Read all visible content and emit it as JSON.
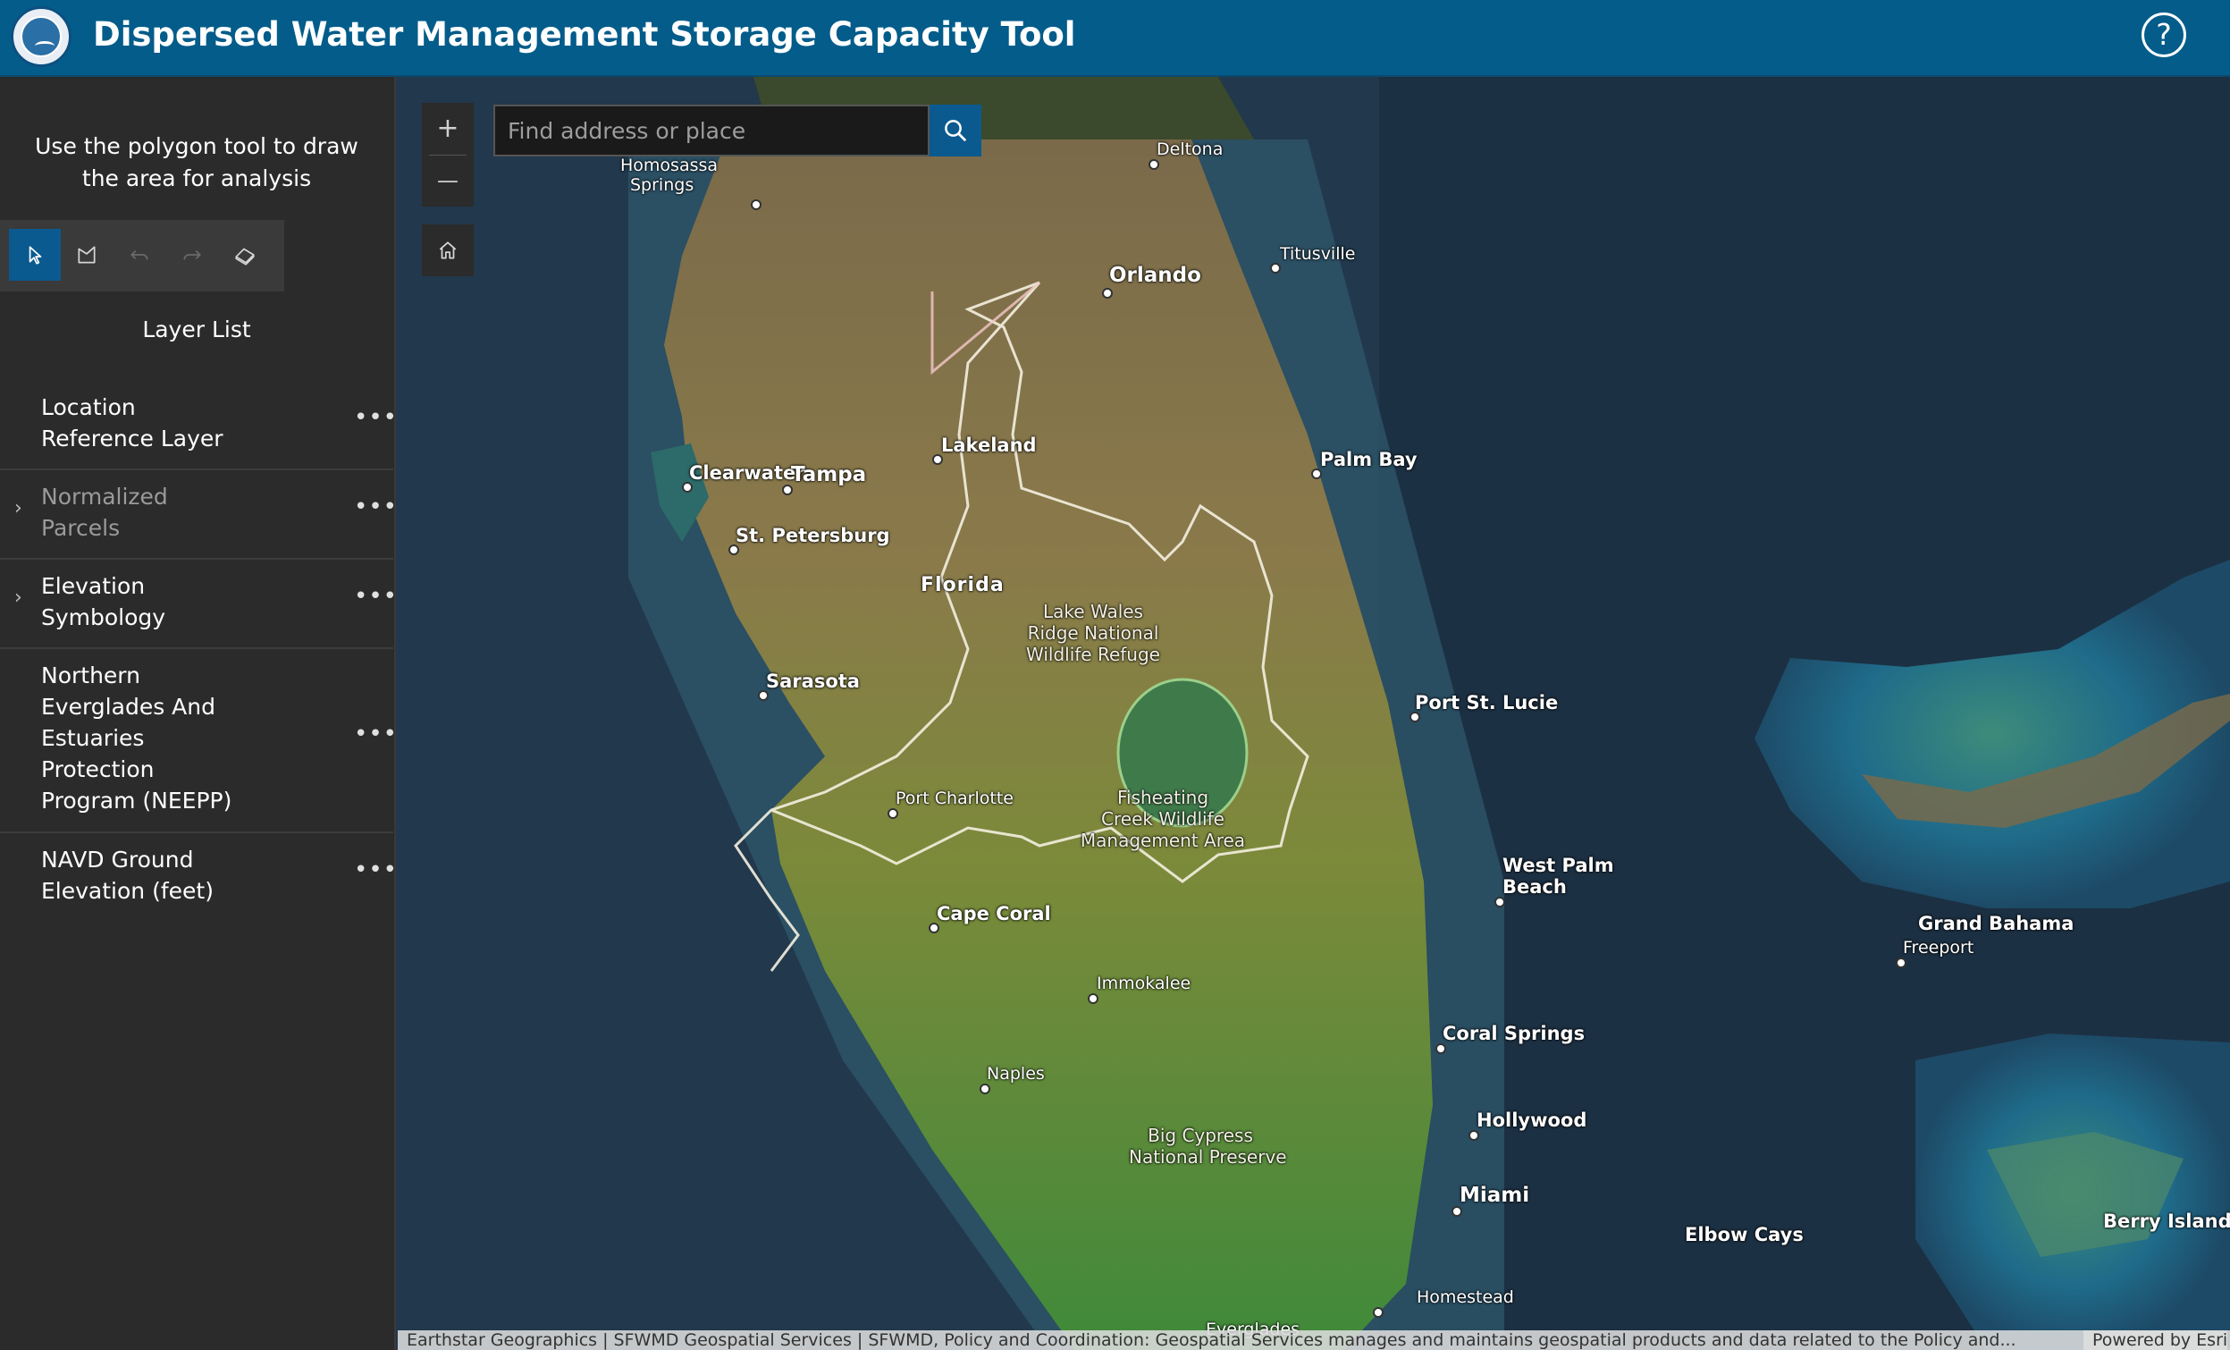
{
  "header": {
    "title": "Dispersed Water Management Storage Capacity Tool",
    "help_label": "?",
    "logo_icon": "district-seal-logo"
  },
  "sidebar": {
    "instructions": "Use the polygon tool to draw the area for analysis",
    "sketch_tools": [
      {
        "name": "select-tool",
        "icon": "cursor-icon",
        "active": true
      },
      {
        "name": "polygon-tool",
        "icon": "polygon-icon",
        "active": false
      },
      {
        "name": "undo-tool",
        "icon": "undo-icon",
        "active": false
      },
      {
        "name": "redo-tool",
        "icon": "redo-icon",
        "active": false
      },
      {
        "name": "erase-tool",
        "icon": "eraser-icon",
        "active": false
      }
    ],
    "layer_list_title": "Layer List",
    "layers": [
      {
        "line1": "Location",
        "line2": "Reference Layer",
        "expandable": false,
        "options": "..."
      },
      {
        "line1": "Normalized",
        "line2": "Parcels",
        "expandable": true,
        "options": "..."
      },
      {
        "line1": "Elevation",
        "line2": "Symbology",
        "expandable": true,
        "options": "..."
      },
      {
        "lines": [
          "Northern",
          "Everglades And",
          "Estuaries",
          "Protection",
          "Program (NEEPP)"
        ],
        "expandable": false,
        "options": "..."
      },
      {
        "line1": "NAVD Ground",
        "line2": "Elevation (feet)",
        "expandable": false,
        "options": "..."
      }
    ],
    "collapse_label": "‹"
  },
  "map": {
    "search": {
      "placeholder": "Find address or place",
      "value": ""
    },
    "zoom_in": "+",
    "zoom_out": "—",
    "labels": {
      "homosassa_1": "Homosassa",
      "homosassa_2": "Springs",
      "deltona": "Deltona",
      "orlando": "Orlando",
      "titusville": "Titusville",
      "lakeland": "Lakeland",
      "palm_bay": "Palm Bay",
      "clearwater": "Clearwater",
      "tampa": "Tampa",
      "st_petersburg": "St. Petersburg",
      "florida": "Florida",
      "lake_wales_1": "Lake Wales",
      "lake_wales_2": "Ridge National",
      "lake_wales_3": "Wildlife Refuge",
      "sarasota": "Sarasota",
      "port_st_lucie": "Port St. Lucie",
      "port_charlotte": "Port Charlotte",
      "fisheating_1": "Fisheating",
      "fisheating_2": "Creek Wildlife",
      "fisheating_3": "Management Area",
      "west_palm_1": "West Palm",
      "west_palm_2": "Beach",
      "cape_coral": "Cape Coral",
      "immokalee": "Immokalee",
      "grand_bahama": "Grand Bahama",
      "freeport": "Freeport",
      "coral_springs": "Coral Springs",
      "naples": "Naples",
      "hollywood": "Hollywood",
      "big_cypress_1": "Big Cypress",
      "big_cypress_2": "National Preserve",
      "miami": "Miami",
      "berry_islands": "Berry Islands",
      "elbow_cays": "Elbow Cays",
      "homestead": "Homestead",
      "everglades": "Everglades"
    },
    "attribution": "Earthstar Geographics | SFWMD Geospatial Services | SFWMD, Policy and Coordination: Geospatial Services manages and maintains geospatial products and data related to the Policy and...",
    "powered_by": "Powered by Esri"
  },
  "colors": {
    "header_bg": "#035c8a",
    "sidebar_bg": "#2b2b2b",
    "active_tool": "#0a5a8f",
    "ocean": "#1f3447"
  }
}
